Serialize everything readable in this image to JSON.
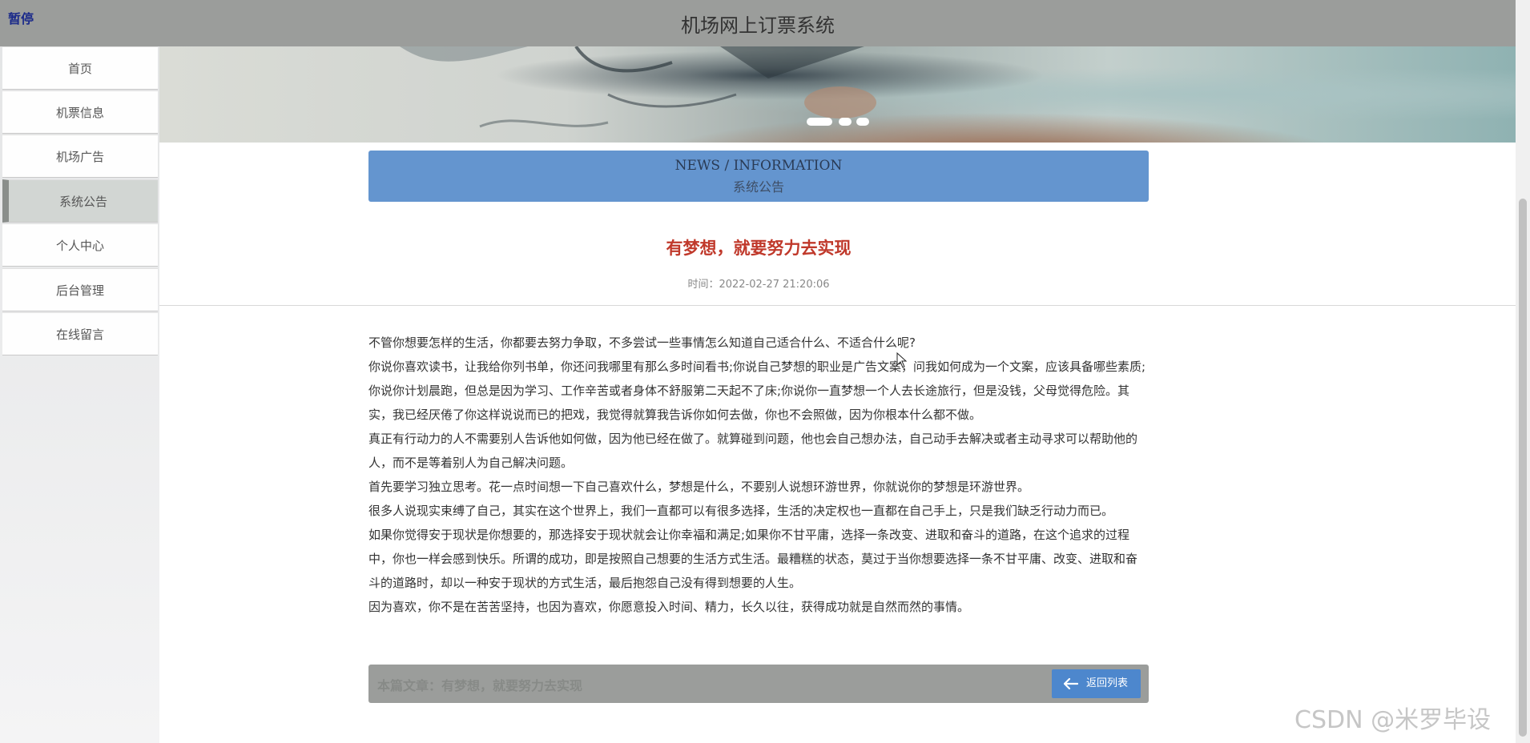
{
  "header": {
    "pause_label": "暂停",
    "site_title": "机场网上订票系统"
  },
  "sidebar": {
    "items": [
      {
        "label": "首页"
      },
      {
        "label": "机票信息"
      },
      {
        "label": "机场广告"
      },
      {
        "label": "系统公告",
        "active": true
      },
      {
        "label": "个人中心"
      },
      {
        "label": "后台管理"
      },
      {
        "label": "在线留言"
      }
    ]
  },
  "banner": {
    "carousel_slide_count": 3,
    "carousel_active_index": 0
  },
  "news_header": {
    "en": "NEWS / INFORMATION",
    "cn": "系统公告"
  },
  "article": {
    "title": "有梦想，就要努力去实现",
    "time": "时间：2022-02-27 21:20:06",
    "paragraphs": [
      "不管你想要怎样的生活，你都要去努力争取，不多尝试一些事情怎么知道自己适合什么、不适合什么呢?",
      "你说你喜欢读书，让我给你列书单，你还问我哪里有那么多时间看书;你说自己梦想的职业是广告文案，问我如何成为一个文案，应该具备哪些素质;你说你计划晨跑，但总是因为学习、工作辛苦或者身体不舒服第二天起不了床;你说你一直梦想一个人去长途旅行，但是没钱，父母觉得危险。其实，我已经厌倦了你这样说说而已的把戏，我觉得就算我告诉你如何去做，你也不会照做，因为你根本什么都不做。",
      "真正有行动力的人不需要别人告诉他如何做，因为他已经在做了。就算碰到问题，他也会自己想办法，自己动手去解决或者主动寻求可以帮助他的人，而不是等着别人为自己解决问题。",
      "首先要学习独立思考。花一点时间想一下自己喜欢什么，梦想是什么，不要别人说想环游世界，你就说你的梦想是环游世界。",
      "很多人说现实束缚了自己，其实在这个世界上，我们一直都可以有很多选择，生活的决定权也一直都在自己手上，只是我们缺乏行动力而已。",
      "如果你觉得安于现状是你想要的，那选择安于现状就会让你幸福和满足;如果你不甘平庸，选择一条改变、进取和奋斗的道路，在这个追求的过程中，你也一样会感到快乐。所谓的成功，即是按照自己想要的生活方式生活。最糟糕的状态，莫过于当你想要选择一条不甘平庸、改变、进取和奋斗的道路时，却以一种安于现状的方式生活，最后抱怨自己没有得到想要的人生。",
      "因为喜欢，你不是在苦苦坚持，也因为喜欢，你愿意投入时间、精力，长久以往，获得成功就是自然而然的事情。"
    ]
  },
  "footer": {
    "current_article": "本篇文章：有梦想，就要努力去实现",
    "back_label": "返回列表"
  },
  "watermark": "CSDN @米罗毕设"
}
